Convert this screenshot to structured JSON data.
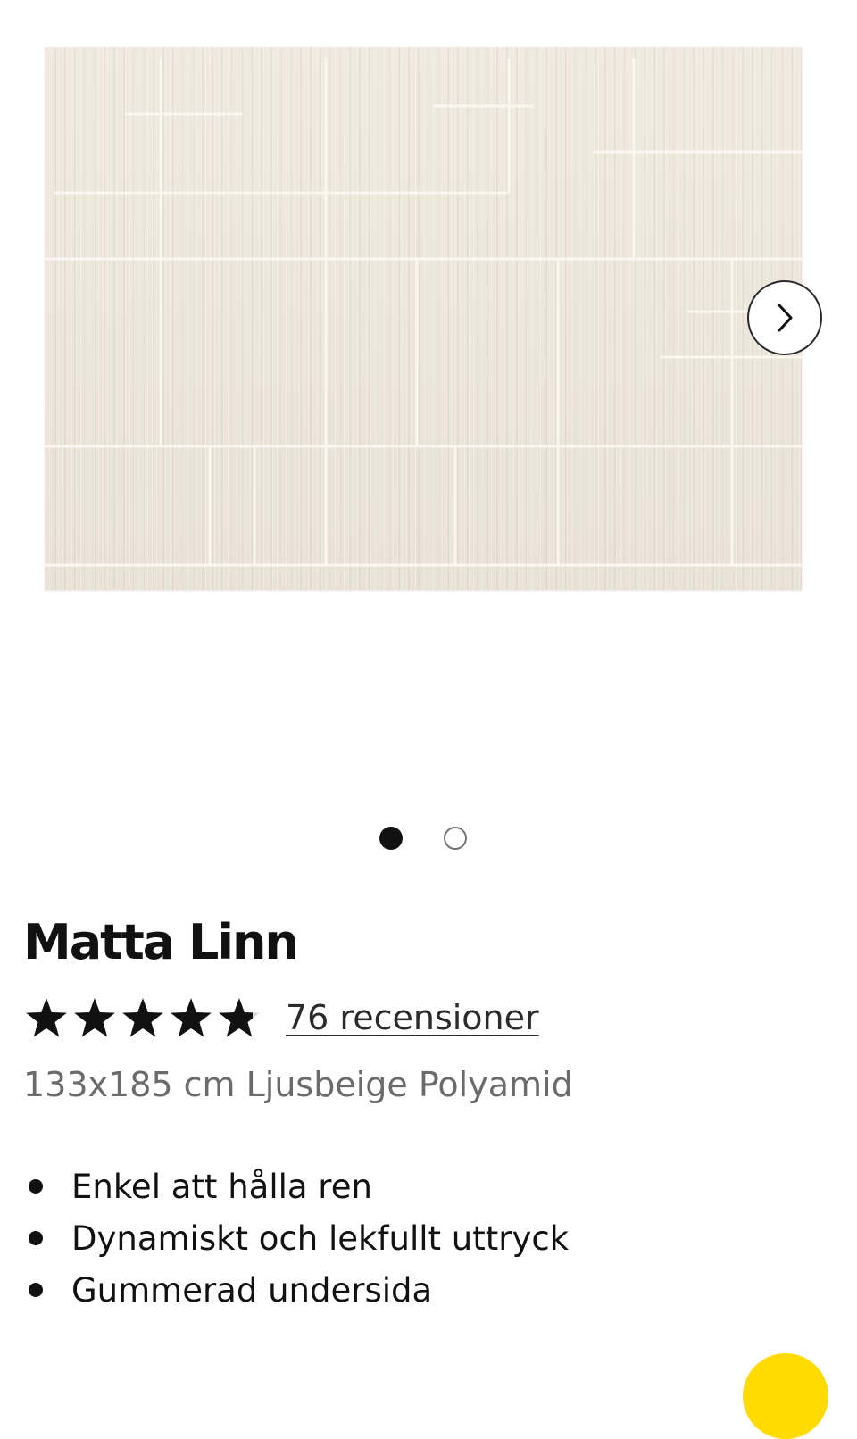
{
  "gallery": {
    "image_alt": "Matta Linn",
    "next_icon": "chevron-right-icon",
    "slide_count": 2,
    "active_slide": 1
  },
  "product": {
    "title": "Matta Linn",
    "rating": {
      "stars": 4.8,
      "max": 5,
      "reviews_label": "76 recensioner"
    },
    "subtitle": "133x185 cm Ljusbeige Polyamid",
    "features": [
      "Enkel att hålla ren",
      "Dynamiskt och lekfullt uttryck",
      "Gummerad undersida"
    ]
  },
  "colors": {
    "rug": "#ece6db",
    "chat_button": "#ffdb00",
    "text": "#111111",
    "muted_text": "#6b6b6b"
  }
}
